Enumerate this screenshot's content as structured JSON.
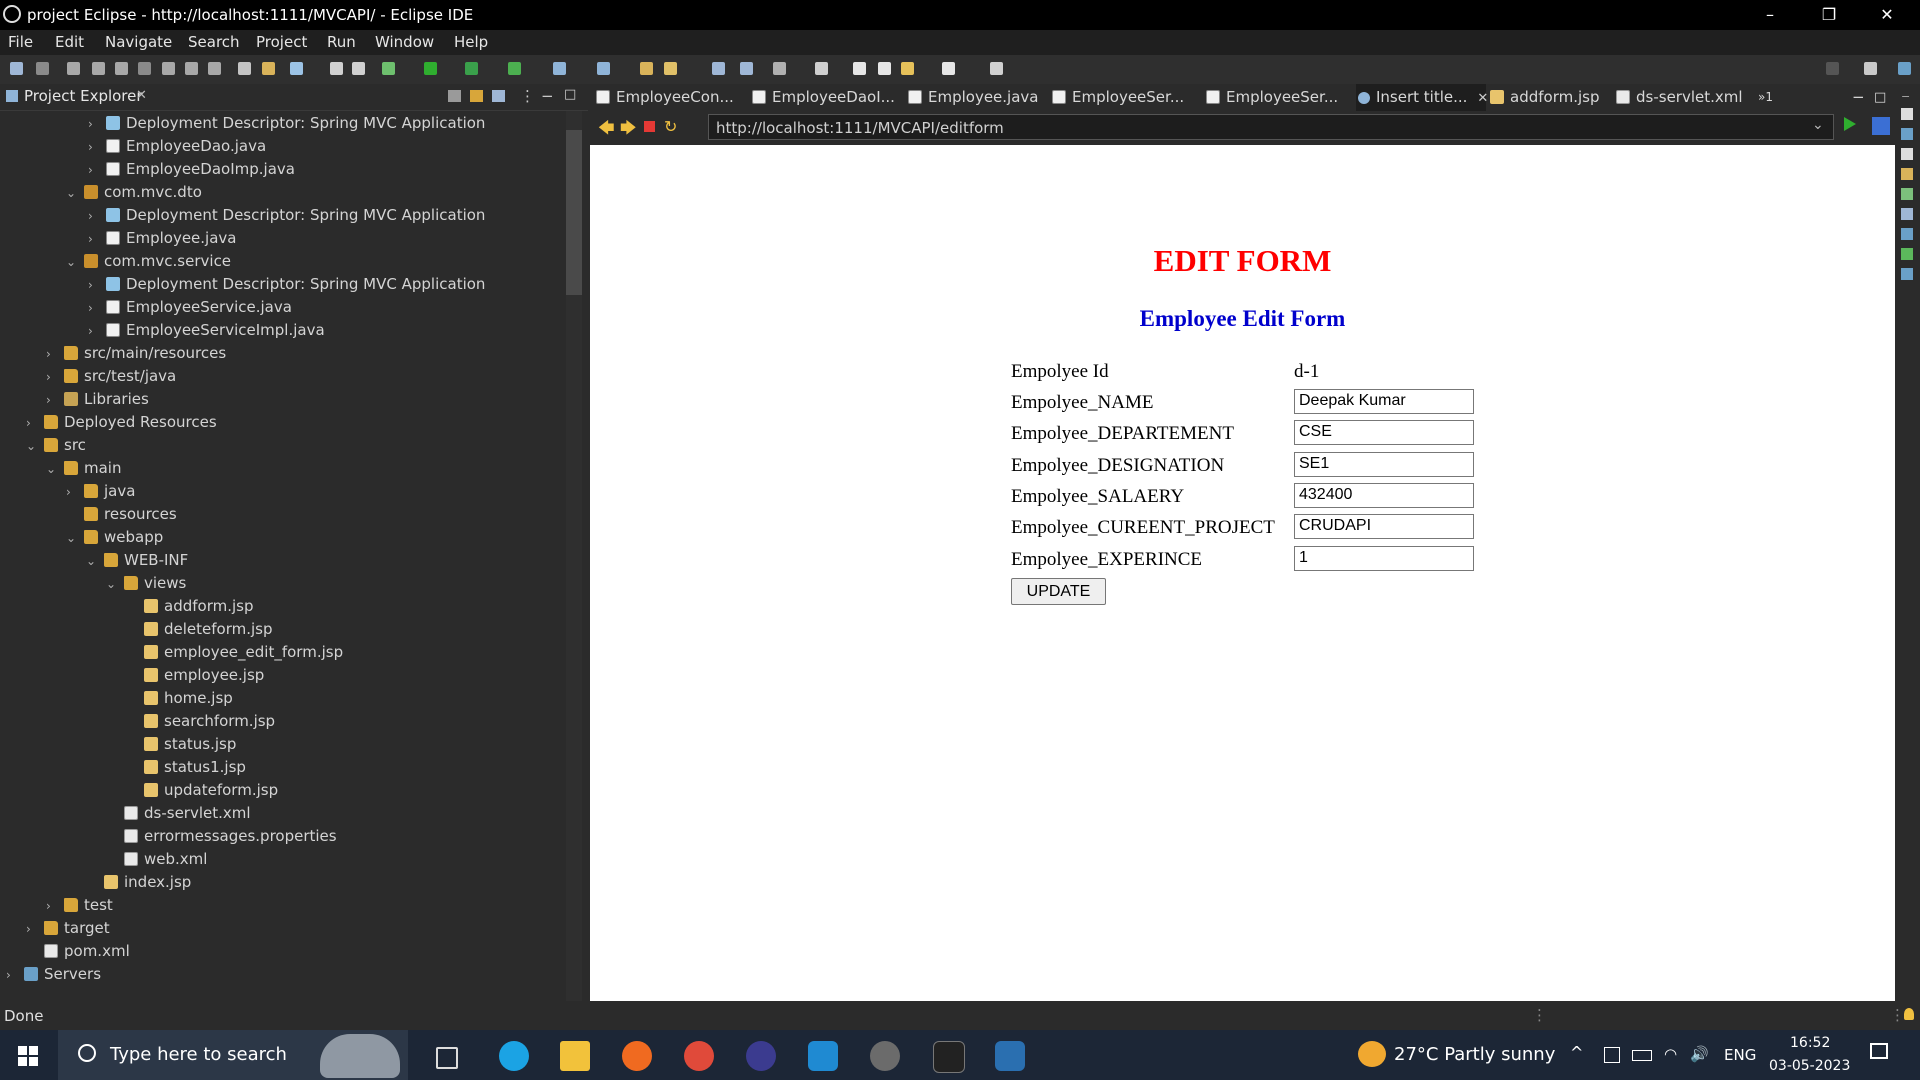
{
  "window": {
    "title": "project Eclipse - http://localhost:1111/MVCAPI/ - Eclipse IDE",
    "minimize": "–",
    "maximize": "❐",
    "close": "✕"
  },
  "menu": [
    "File",
    "Edit",
    "Navigate",
    "Search",
    "Project",
    "Run",
    "Window",
    "Help"
  ],
  "explorer": {
    "title": "Project Explorer",
    "close": "✕",
    "tree": [
      {
        "label": "Deployment Descriptor: Spring MVC Application",
        "icon": "dd",
        "chev": "›"
      },
      {
        "label": "EmployeeDao.java",
        "icon": "java",
        "chev": "›"
      },
      {
        "label": "EmployeeDaoImp.java",
        "icon": "java",
        "chev": "›"
      },
      {
        "label": "com.mvc.dto",
        "icon": "pkg",
        "chev": "⌄"
      },
      {
        "label": "Deployment Descriptor: Spring MVC Application",
        "icon": "dd",
        "chev": "›"
      },
      {
        "label": "Employee.java",
        "icon": "java",
        "chev": "›"
      },
      {
        "label": "com.mvc.service",
        "icon": "pkg",
        "chev": "⌄"
      },
      {
        "label": "Deployment Descriptor: Spring MVC Application",
        "icon": "dd",
        "chev": "›"
      },
      {
        "label": "EmployeeService.java",
        "icon": "java",
        "chev": "›"
      },
      {
        "label": "EmployeeServiceImpl.java",
        "icon": "java",
        "chev": "›"
      },
      {
        "label": "src/main/resources",
        "icon": "folder",
        "chev": "›"
      },
      {
        "label": "src/test/java",
        "icon": "folder",
        "chev": "›"
      },
      {
        "label": "Libraries",
        "icon": "lib",
        "chev": "›"
      },
      {
        "label": "Deployed Resources",
        "icon": "folder",
        "chev": "›"
      },
      {
        "label": "src",
        "icon": "folder",
        "chev": "⌄"
      },
      {
        "label": "main",
        "icon": "folder",
        "chev": "⌄"
      },
      {
        "label": "java",
        "icon": "folder",
        "chev": "›"
      },
      {
        "label": "resources",
        "icon": "folder",
        "chev": ""
      },
      {
        "label": "webapp",
        "icon": "folder",
        "chev": "⌄"
      },
      {
        "label": "WEB-INF",
        "icon": "folder",
        "chev": "⌄"
      },
      {
        "label": "views",
        "icon": "folder",
        "chev": "⌄"
      },
      {
        "label": "addform.jsp",
        "icon": "jsp",
        "chev": ""
      },
      {
        "label": "deleteform.jsp",
        "icon": "jsp",
        "chev": ""
      },
      {
        "label": "employee_edit_form.jsp",
        "icon": "jsp",
        "chev": ""
      },
      {
        "label": "employee.jsp",
        "icon": "jsp",
        "chev": ""
      },
      {
        "label": "home.jsp",
        "icon": "jsp",
        "chev": ""
      },
      {
        "label": "searchform.jsp",
        "icon": "jsp",
        "chev": ""
      },
      {
        "label": "status.jsp",
        "icon": "jsp",
        "chev": ""
      },
      {
        "label": "status1.jsp",
        "icon": "jsp",
        "chev": ""
      },
      {
        "label": "updateform.jsp",
        "icon": "jsp",
        "chev": ""
      },
      {
        "label": "ds-servlet.xml",
        "icon": "xml",
        "chev": ""
      },
      {
        "label": "errormessages.properties",
        "icon": "xml",
        "chev": ""
      },
      {
        "label": "web.xml",
        "icon": "xml",
        "chev": ""
      },
      {
        "label": "index.jsp",
        "icon": "jsp",
        "chev": ""
      },
      {
        "label": "test",
        "icon": "folder",
        "chev": "›"
      },
      {
        "label": "target",
        "icon": "folder",
        "chev": "›"
      },
      {
        "label": "pom.xml",
        "icon": "xml",
        "chev": ""
      },
      {
        "label": "Servers",
        "icon": "srv",
        "chev": "›"
      }
    ]
  },
  "tabs": [
    {
      "label": "EmployeeCon..."
    },
    {
      "label": "EmployeeDaoI..."
    },
    {
      "label": "Employee.java"
    },
    {
      "label": "EmployeeSer..."
    },
    {
      "label": "EmployeeSer..."
    },
    {
      "label": "Insert title...",
      "close": "✕"
    },
    {
      "label": "addform.jsp"
    },
    {
      "label": "ds-servlet.xml"
    }
  ],
  "tabs_overflow": "»1",
  "browser": {
    "url": "http://localhost:1111/MVCAPI/editform",
    "heading": "EDIT FORM",
    "subheading": "Employee Edit Form",
    "id_label": "Empolyee Id",
    "id_value": "d-1",
    "fields": [
      {
        "label": "Empolyee_NAME",
        "value": "Deepak Kumar"
      },
      {
        "label": "Empolyee_DEPARTEMENT",
        "value": "CSE"
      },
      {
        "label": "Empolyee_DESIGNATION",
        "value": "SE1"
      },
      {
        "label": "Empolyee_SALAERY",
        "value": "432400"
      },
      {
        "label": "Empolyee_CUREENT_PROJECT",
        "value": "CRUDAPI"
      },
      {
        "label": "Empolyee_EXPERINCE",
        "value": "1"
      }
    ],
    "submit": "UPDATE"
  },
  "status": {
    "text": "Done"
  },
  "taskbar": {
    "search_placeholder": "Type here to search",
    "weather": "27°C  Partly sunny",
    "lang": "ENG",
    "time": "16:52",
    "date": "03-05-2023"
  },
  "colors": {
    "heading": "#ff0000",
    "subheading": "#0000cc",
    "accent": "#4d8ec9"
  }
}
